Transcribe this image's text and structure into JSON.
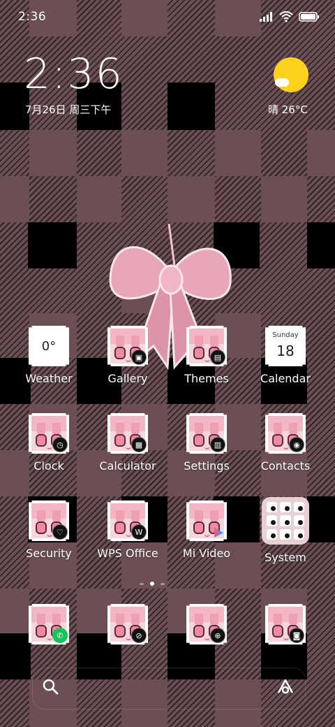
{
  "status_bar": {
    "time": "2:36",
    "icons": [
      "signal-icon",
      "wifi-icon",
      "battery-icon"
    ]
  },
  "clock_widget": {
    "time": "2:36",
    "date": "7月26日 周三下午"
  },
  "weather_widget": {
    "text": "晴 26°C",
    "icon": "sunny-cloud-icon"
  },
  "apps_row1": [
    {
      "label": "Weather",
      "tile_text": "0°"
    },
    {
      "label": "Gallery"
    },
    {
      "label": "Themes"
    },
    {
      "label": "Calendar",
      "cal_day": "Sunday",
      "cal_num": "18"
    }
  ],
  "apps_row2": [
    {
      "label": "Clock"
    },
    {
      "label": "Calculator"
    },
    {
      "label": "Settings"
    },
    {
      "label": "Contacts"
    }
  ],
  "apps_row3": [
    {
      "label": "Security"
    },
    {
      "label": "WPS Office"
    },
    {
      "label": "Mi Video"
    },
    {
      "label": "System"
    }
  ],
  "dock": [
    {
      "name": "phone"
    },
    {
      "name": "browser"
    },
    {
      "name": "globe"
    },
    {
      "name": "camera"
    }
  ],
  "colors": {
    "bg": "#6b4f55",
    "sun": "#ffd11f",
    "pink": "#f3b6c4",
    "phone_green": "#17c45a"
  }
}
